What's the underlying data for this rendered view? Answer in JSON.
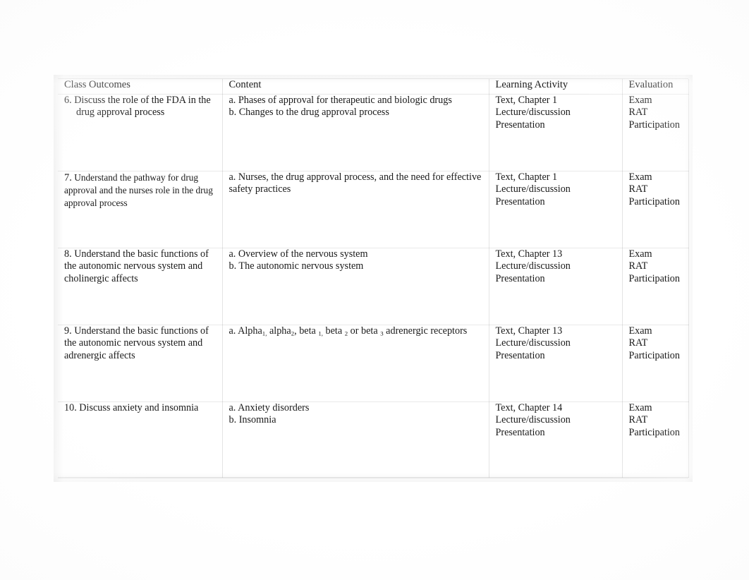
{
  "table": {
    "headers": [
      "Class Outcomes",
      "Content",
      "Learning Activity",
      "Evaluation"
    ],
    "rows": [
      {
        "outcome_number": "6.",
        "outcome_line1": "Discuss the role of the FDA in the",
        "outcome_line2": "drug approval process",
        "outcome_full": "6. Discuss the role of the FDA in the drug approval process",
        "content": [
          "a. Phases of approval for therapeutic and biologic drugs",
          "b. Changes to the drug approval process"
        ],
        "learning_activity": [
          "Text, Chapter 1",
          "Lecture/discussion",
          "Presentation"
        ],
        "evaluation": [
          "Exam",
          "RAT",
          "Participation"
        ]
      },
      {
        "outcome_number": "7.",
        "outcome_body": "Understand the pathway for drug approval and the nurses role in the drug approval process",
        "outcome_full": "7. Understand the pathway for drug approval and the nurses role in the drug approval process",
        "content": [
          "a. Nurses, the drug approval process, and the need for effective safety practices"
        ],
        "learning_activity": [
          "Text, Chapter 1",
          "Lecture/discussion",
          "Presentation"
        ],
        "evaluation": [
          "Exam",
          "RAT",
          "Participation"
        ]
      },
      {
        "outcome_number": "8.",
        "outcome_body": "Understand the basic functions of the autonomic nervous system and cholinergic affects",
        "outcome_full": "8.  Understand the basic functions of the autonomic nervous system and cholinergic affects",
        "content": [
          "a.  Overview of the nervous system",
          "b. The autonomic nervous system"
        ],
        "learning_activity": [
          "Text, Chapter 13",
          "Lecture/discussion",
          "Presentation"
        ],
        "evaluation": [
          "Exam",
          "RAT",
          "Participation"
        ]
      },
      {
        "outcome_number": "9.",
        "outcome_body": "Understand the basic functions of the autonomic nervous system and adrenergic affects",
        "outcome_full": "9.  Understand the basic functions of the autonomic nervous system and adrenergic affects",
        "content_rich": {
          "marker": "a.  ",
          "segments": [
            {
              "text": "Alpha"
            },
            {
              "text": "1,",
              "sub": true
            },
            {
              "text": " alpha"
            },
            {
              "text": "2",
              "sub": true
            },
            {
              "text": ", beta "
            },
            {
              "text": "1,",
              "sub": true
            },
            {
              "text": " beta "
            },
            {
              "text": "2",
              "sub": true
            },
            {
              "text": " or beta "
            },
            {
              "text": "3",
              "sub": true
            },
            {
              "text": " adrenergic receptors"
            }
          ],
          "plain": "a.  Alpha1, alpha2, beta 1, beta 2 or beta 3 adrenergic receptors"
        },
        "learning_activity": [
          "Text, Chapter 13",
          "Lecture/discussion",
          "Presentation"
        ],
        "evaluation": [
          "Exam",
          "RAT",
          "Participation"
        ]
      },
      {
        "outcome_number": "10.",
        "outcome_body": "Discuss anxiety and insomnia",
        "outcome_full": "10.  Discuss anxiety and insomnia",
        "content": [
          "a.  Anxiety disorders",
          "b.  Insomnia"
        ],
        "learning_activity": [
          "Text, Chapter 14",
          "Lecture/discussion",
          "Presentation"
        ],
        "evaluation": [
          "Exam",
          "RAT",
          "Participation"
        ]
      }
    ]
  }
}
